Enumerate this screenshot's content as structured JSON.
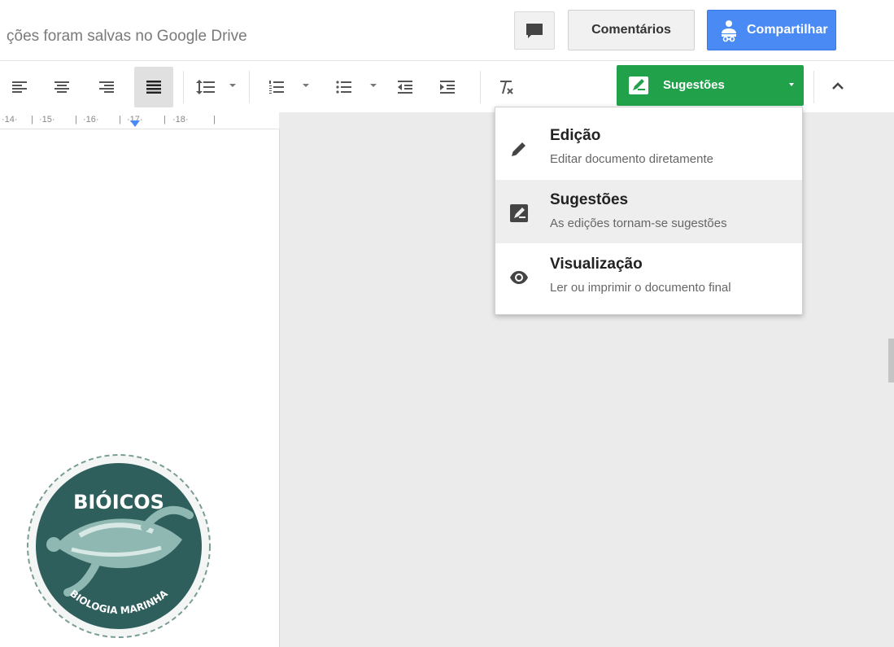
{
  "header": {
    "save_status": "ções foram salvas no Google Drive",
    "comments_label": "Comentários",
    "share_label": "Compartilhar"
  },
  "toolbar": {
    "mode_label": "Sugestões"
  },
  "ruler": {
    "ticks": [
      "·14·",
      "|",
      "·15·",
      "|",
      "·16·",
      "|",
      "·17·",
      "|",
      "·18·",
      "|"
    ]
  },
  "mode_menu": {
    "items": [
      {
        "title": "Edição",
        "description": "Editar documento diretamente",
        "icon": "pencil-icon",
        "active": false
      },
      {
        "title": "Sugestões",
        "description": "As edições tornam-se sugestões",
        "icon": "suggest-icon",
        "active": true
      },
      {
        "title": "Visualização",
        "description": "Ler ou imprimir o documento final",
        "icon": "eye-icon",
        "active": false
      }
    ]
  },
  "logo": {
    "top_text": "BIÓICOS",
    "bottom_text": "BIOLOGIA MARINHA"
  },
  "colors": {
    "share_blue": "#4a8af4",
    "suggest_green": "#22a14b",
    "logo_teal": "#2f5f5c"
  }
}
